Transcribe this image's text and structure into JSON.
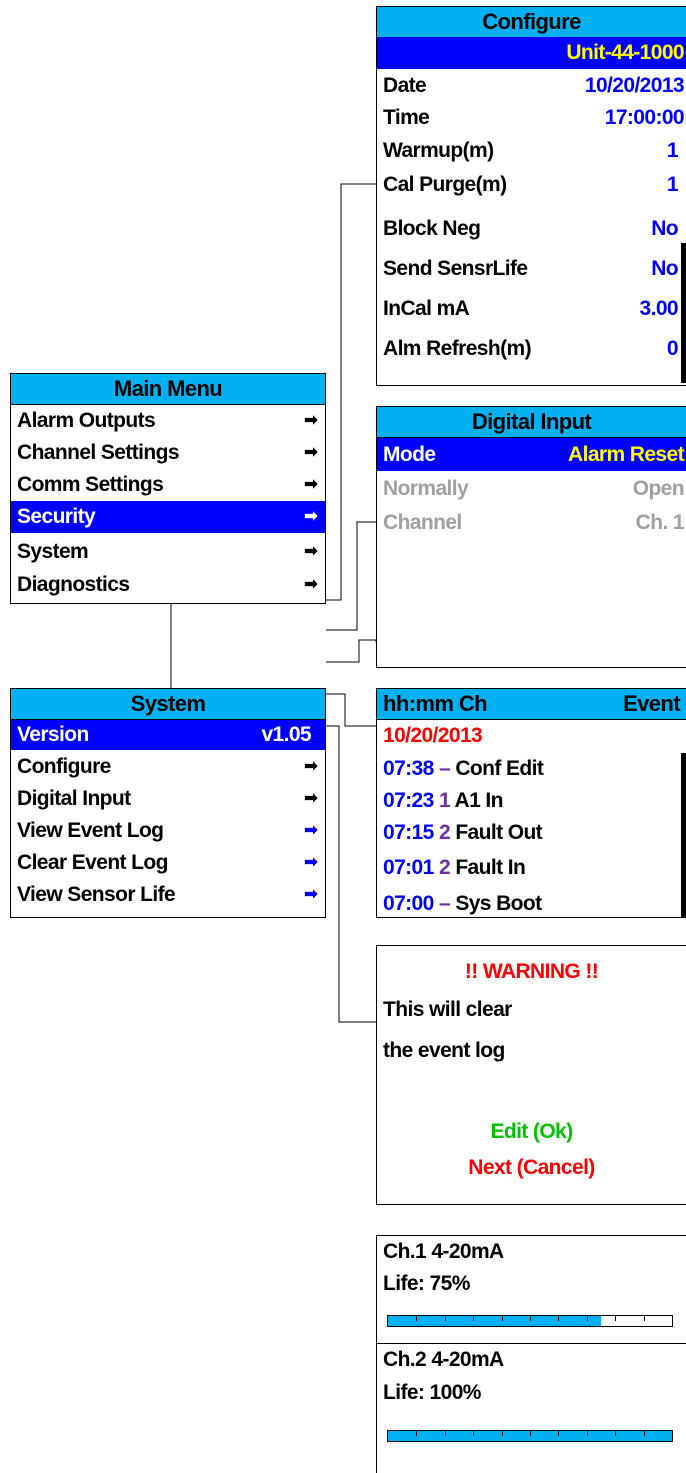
{
  "main_menu": {
    "title": "Main Menu",
    "items": [
      {
        "label": "Alarm Outputs"
      },
      {
        "label": "Channel Settings"
      },
      {
        "label": "Comm Settings"
      },
      {
        "label": "Security"
      },
      {
        "label": "System"
      },
      {
        "label": "Diagnostics"
      }
    ],
    "selected_index": 3
  },
  "system": {
    "title": "System",
    "version_label": "Version",
    "version_value": "v1.05",
    "items": [
      {
        "label": "Configure"
      },
      {
        "label": "Digital Input"
      },
      {
        "label": "View Event Log"
      },
      {
        "label": "Clear Event Log"
      },
      {
        "label": "View Sensor Life"
      }
    ]
  },
  "configure": {
    "title": "Configure",
    "unit": "Unit-44-1000",
    "rows": [
      {
        "label": "Date",
        "value": "10/20/2013"
      },
      {
        "label": "Time",
        "value": "17:00:00"
      },
      {
        "label": "Warmup(m)",
        "value": "1"
      },
      {
        "label": "Cal Purge(m)",
        "value": "1"
      },
      {
        "label": "Block Neg",
        "value": "No"
      },
      {
        "label": "Send SensrLife",
        "value": "No"
      },
      {
        "label": "InCal mA",
        "value": "3.00"
      },
      {
        "label": "Alm Refresh(m)",
        "value": "0"
      }
    ]
  },
  "digital_input": {
    "title": "Digital Input",
    "mode_label": "Mode",
    "mode_value": "Alarm Reset",
    "normally_label": "Normally",
    "normally_value": "Open",
    "channel_label": "Channel",
    "channel_value": "Ch. 1"
  },
  "event_log": {
    "header_left": "hh:mm Ch",
    "header_right": "Event",
    "date": "10/20/2013",
    "entries": [
      {
        "time": "07:38",
        "ch": "–",
        "event": "Conf Edit"
      },
      {
        "time": "07:23",
        "ch": "1",
        "event": "A1 In"
      },
      {
        "time": "07:15",
        "ch": "2",
        "event": "Fault Out"
      },
      {
        "time": "07:01",
        "ch": "2",
        "event": "Fault In"
      },
      {
        "time": "07:00",
        "ch": "–",
        "event": "Sys Boot"
      }
    ]
  },
  "warning": {
    "title": "!! WARNING !!",
    "line1": "This will clear",
    "line2": "the event log",
    "ok": "Edit (Ok)",
    "cancel": "Next (Cancel)"
  },
  "sensor_life": {
    "channels": [
      {
        "name": "Ch.1 4-20mA",
        "life_text": "Life: 75%",
        "life_fraction": 0.75
      },
      {
        "name": "Ch.2 4-20mA",
        "life_text": "Life: 100%",
        "life_fraction": 1.0
      }
    ]
  },
  "colors": {
    "header": "#00b0f0",
    "selected": "#0000ff",
    "value_blue": "#0000ff",
    "highlight_yellow": "#ffff00",
    "warning_red": "#ff0000",
    "ok_green": "#00c000",
    "channel_purple": "#7030a0"
  }
}
